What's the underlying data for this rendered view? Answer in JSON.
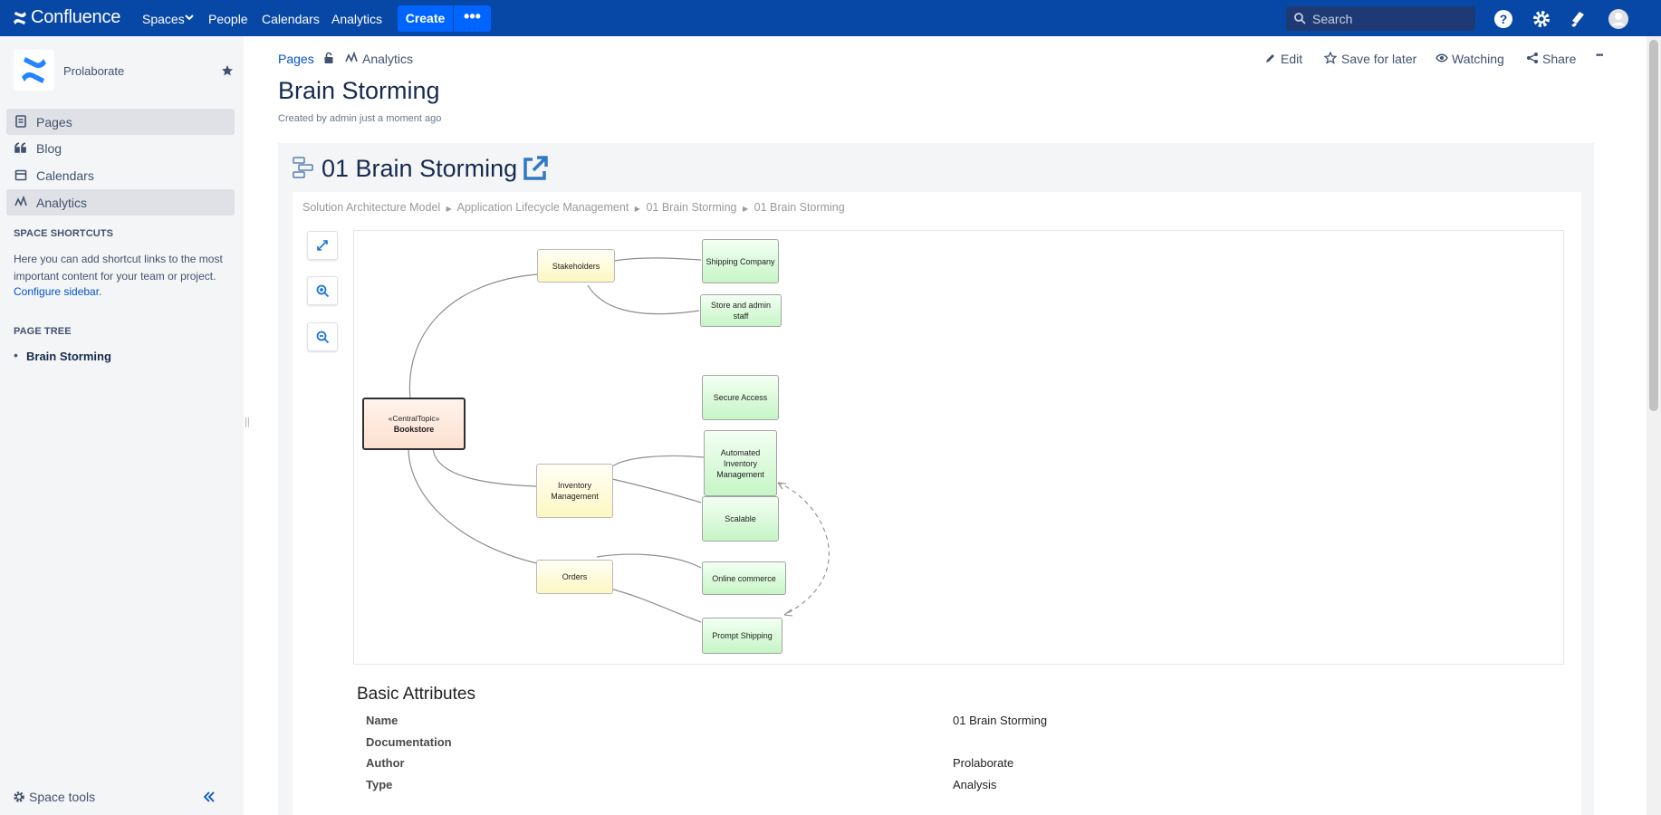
{
  "topnav": {
    "logo": "Confluence",
    "items": [
      "Spaces",
      "People",
      "Calendars",
      "Analytics"
    ],
    "create": "Create",
    "more": "•••",
    "search_placeholder": "Search"
  },
  "sidebar": {
    "space_name": "Prolaborate",
    "nav": [
      "Pages",
      "Blog",
      "Calendars",
      "Analytics"
    ],
    "shortcuts_heading": "SPACE SHORTCUTS",
    "shortcuts_text": "Here you can add shortcut links to the most important content for your team or project.",
    "configure_link": "Configure sidebar.",
    "tree_heading": "PAGE TREE",
    "tree_item": "Brain Storming",
    "space_tools": "Space tools"
  },
  "breadcrumb": {
    "pages": "Pages",
    "analytics": "Analytics"
  },
  "actions": {
    "edit": "Edit",
    "save": "Save for later",
    "watch": "Watching",
    "share": "Share",
    "more": "•••"
  },
  "page": {
    "title": "Brain Storming",
    "byline": "Created by admin just a moment ago"
  },
  "diagram": {
    "title": "01 Brain Storming",
    "path": [
      "Solution Architecture Model",
      "Application Lifecycle Management",
      "01 Brain Storming",
      "01 Brain Storming"
    ],
    "central_stereo": "«CentralTopic»",
    "central_name": "Bookstore",
    "nodes": {
      "stakeholders": "Stakeholders",
      "inventory": "Inventory Management",
      "orders": "Orders",
      "shipping": "Shipping Company",
      "staff": "Store and admin staff",
      "secure": "Secure Access",
      "automated": "Automated Inventory Management",
      "scalable": "Scalable",
      "online": "Online commerce",
      "prompt": "Prompt Shipping"
    }
  },
  "attributes": {
    "heading": "Basic Attributes",
    "rows": [
      {
        "key": "Name",
        "value": "01 Brain Storming"
      },
      {
        "key": "Documentation",
        "value": ""
      },
      {
        "key": "Author",
        "value": "Prolaborate"
      },
      {
        "key": "Type",
        "value": "Analysis"
      }
    ]
  },
  "colors": {
    "nav": "#0747a6",
    "primary": "#0065ff",
    "link": "#0052cc",
    "sidebar": "#f4f5f7"
  }
}
